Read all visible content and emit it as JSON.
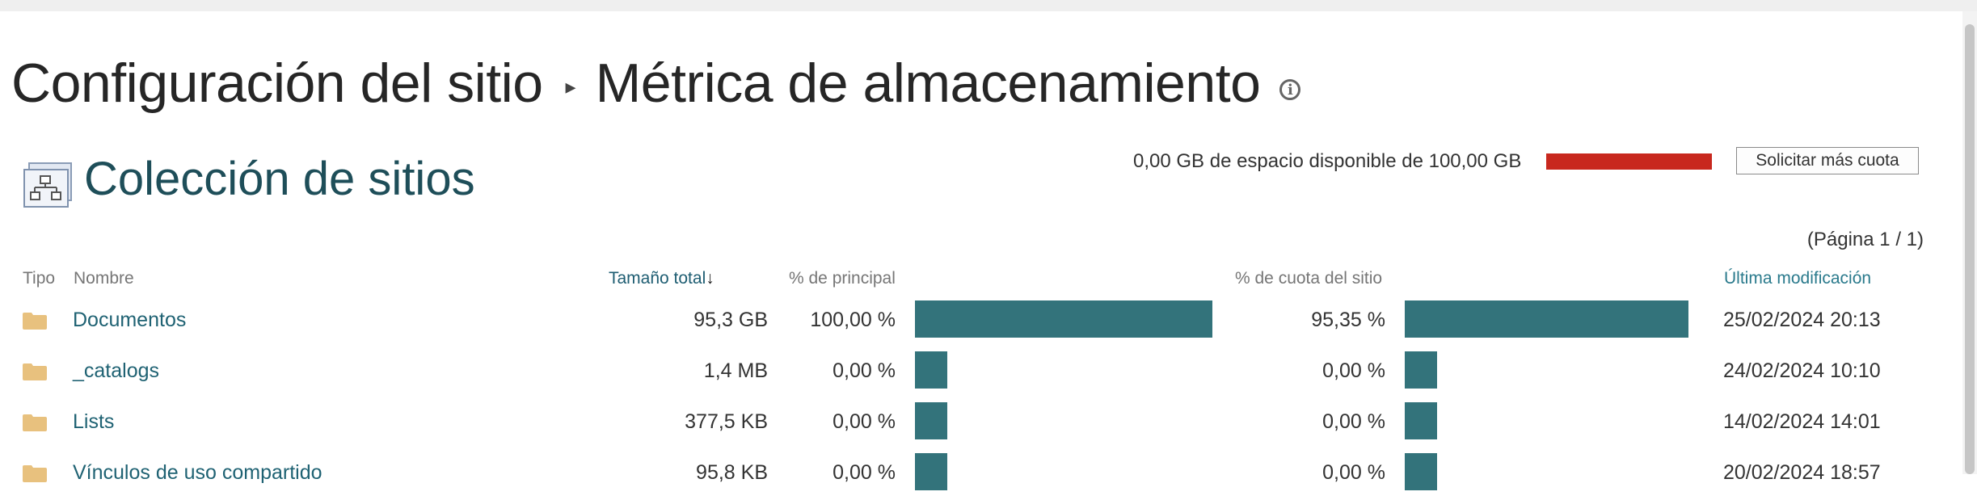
{
  "breadcrumb": {
    "parent": "Configuración del sitio",
    "separator": "▸",
    "current": "Métrica de almacenamiento",
    "info_icon": "info-icon"
  },
  "section": {
    "title": "Colección de sitios",
    "icon": "site-collection-icon"
  },
  "quota": {
    "text": "0,00 GB de espacio disponible de 100,00 GB",
    "used_fraction": 1.0,
    "bar_color": "#c8281e",
    "button_label": "Solicitar más cuota"
  },
  "pager": {
    "text": "(Página 1 / 1)"
  },
  "table": {
    "headers": {
      "type": "Tipo",
      "name": "Nombre",
      "total_size": "Tamaño total",
      "sort_arrow": "↓",
      "parent_pct": "% de principal",
      "quota_pct": "% de cuota del sitio",
      "modified": "Última modificación"
    },
    "bar_color": "#33737b",
    "rows": [
      {
        "name": "Documentos",
        "size": "95,3 GB",
        "parent_pct": "100,00 %",
        "parent_value": 100.0,
        "quota_pct": "95,35 %",
        "quota_value": 95.35,
        "modified": "25/02/2024 20:13"
      },
      {
        "name": "_catalogs",
        "size": "1,4 MB",
        "parent_pct": "0,00 %",
        "parent_value": 0.0,
        "quota_pct": "0,00 %",
        "quota_value": 0.0,
        "modified": "24/02/2024 10:10"
      },
      {
        "name": "Lists",
        "size": "377,5 KB",
        "parent_pct": "0,00 %",
        "parent_value": 0.0,
        "quota_pct": "0,00 %",
        "quota_value": 0.0,
        "modified": "14/02/2024 14:01"
      },
      {
        "name": "Vínculos de uso compartido",
        "size": "95,8 KB",
        "parent_pct": "0,00 %",
        "parent_value": 0.0,
        "quota_pct": "0,00 %",
        "quota_value": 0.0,
        "modified": "20/02/2024 18:57"
      }
    ]
  }
}
